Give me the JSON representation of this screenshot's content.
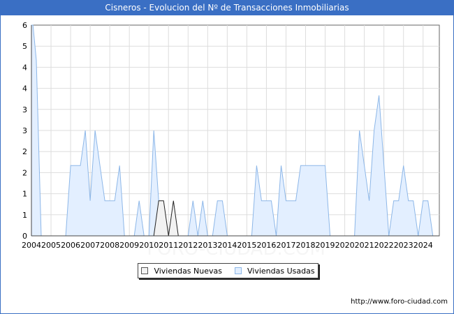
{
  "title": "Cisneros - Evolucion del Nº de Transacciones Inmobiliarias",
  "source": "http://www.foro-ciudad.com",
  "watermark": "FORO-CIUDAD.COM",
  "colors": {
    "title_bg": "#3a6fc4",
    "nuevas_fill": "#f2f2f2",
    "nuevas_line": "#222222",
    "usadas_fill": "#e3efff",
    "usadas_line": "#8db7e8",
    "grid": "#dddddd"
  },
  "chart_data": {
    "type": "area",
    "title": "Cisneros - Evolucion del Nº de Transacciones Inmobiliarias",
    "x_tick_labels": [
      "2004",
      "2005",
      "2006",
      "2007",
      "2008",
      "2009",
      "2010",
      "2011",
      "2012",
      "2013",
      "2014",
      "2015",
      "2016",
      "2017",
      "2018",
      "2019",
      "2020",
      "2021",
      "2022",
      "2023",
      "2024"
    ],
    "y_tick_labels": [
      "0",
      "1",
      "1",
      "2",
      "2",
      "3",
      "3",
      "4",
      "4",
      "5",
      "6"
    ],
    "ylim": [
      0,
      6
    ],
    "xlim": [
      2004.0,
      2024.83
    ],
    "grid": true,
    "legend_position": "bottom-center",
    "series": [
      {
        "name": "Viviendas Nuevas",
        "x": [
          2010.25,
          2010.5,
          2010.75,
          2011.0,
          2011.25,
          2011.5
        ],
        "y": [
          0,
          1,
          1,
          0,
          1,
          0
        ]
      },
      {
        "name": "Viviendas Usadas",
        "x": [
          2004.0,
          2004.08,
          2004.25,
          2004.5,
          2004.75,
          2005.0,
          2005.25,
          2005.5,
          2005.75,
          2006.0,
          2006.25,
          2006.5,
          2006.75,
          2007.0,
          2007.25,
          2007.5,
          2007.75,
          2008.0,
          2008.25,
          2008.5,
          2008.75,
          2009.0,
          2009.25,
          2009.5,
          2009.75,
          2010.0,
          2010.25,
          2010.5,
          2010.75,
          2011.0,
          2011.25,
          2011.5,
          2011.75,
          2012.0,
          2012.25,
          2012.5,
          2012.75,
          2013.0,
          2013.25,
          2013.5,
          2013.75,
          2014.0,
          2014.25,
          2014.5,
          2014.75,
          2015.0,
          2015.25,
          2015.5,
          2015.75,
          2016.0,
          2016.25,
          2016.5,
          2016.75,
          2017.0,
          2017.25,
          2017.5,
          2017.75,
          2018.0,
          2018.25,
          2018.5,
          2018.75,
          2019.0,
          2019.25,
          2019.5,
          2019.75,
          2020.0,
          2020.25,
          2020.5,
          2020.75,
          2021.0,
          2021.25,
          2021.5,
          2021.75,
          2022.0,
          2022.25,
          2022.5,
          2022.75,
          2023.0,
          2023.25,
          2023.5,
          2023.75,
          2024.0,
          2024.25,
          2024.5,
          2024.75
        ],
        "y": [
          6,
          6,
          5,
          0,
          0,
          0,
          0,
          0,
          0,
          2,
          2,
          2,
          3,
          1,
          3,
          2,
          1,
          1,
          1,
          2,
          0,
          0,
          0,
          1,
          0,
          0,
          3,
          1,
          0,
          0,
          0,
          0,
          0,
          0,
          1,
          0,
          1,
          0,
          0,
          1,
          1,
          0,
          0,
          0,
          0,
          0,
          0,
          2,
          1,
          1,
          1,
          0,
          2,
          1,
          1,
          1,
          2,
          2,
          2,
          2,
          2,
          2,
          0,
          0,
          0,
          0,
          0,
          0,
          3,
          2,
          1,
          3,
          4,
          2,
          0,
          1,
          1,
          2,
          1,
          1,
          0,
          1,
          1,
          0,
          0
        ]
      }
    ]
  }
}
